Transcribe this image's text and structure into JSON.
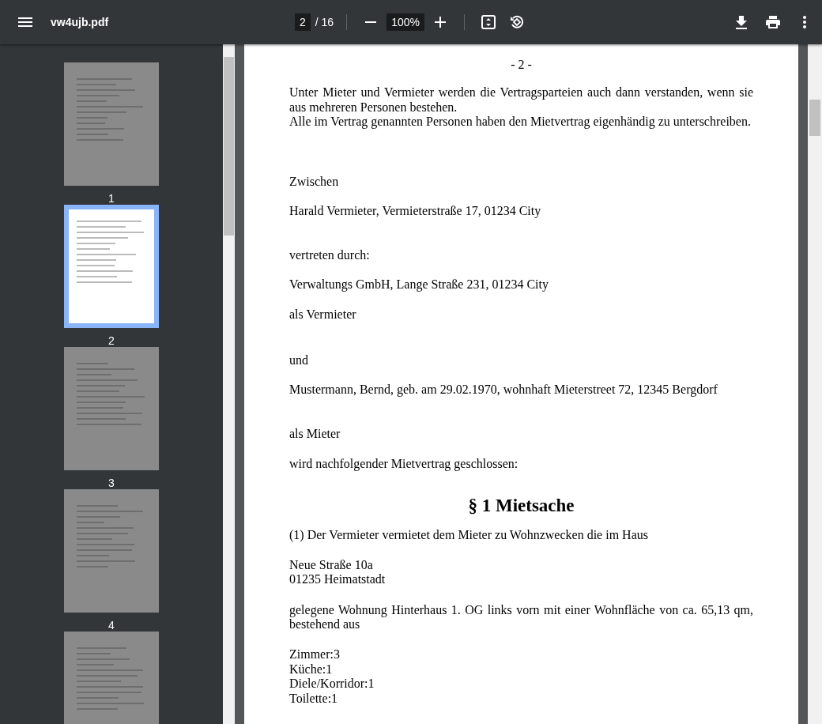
{
  "toolbar": {
    "title": "vw4ujb.pdf",
    "page_input": "2",
    "page_total": "/ 16",
    "zoom": "100%"
  },
  "thumbnails": [
    {
      "label": "1",
      "selected": false
    },
    {
      "label": "2",
      "selected": true
    },
    {
      "label": "3",
      "selected": false
    },
    {
      "label": "4",
      "selected": false
    },
    {
      "selected": false
    }
  ],
  "document": {
    "header": "- 2 -",
    "blocks": [
      {
        "kind": "paragraph",
        "lines": [
          "Unter Mieter und Vermieter werden die Vertragsparteien auch dann verstanden, wenn sie aus mehreren Personen bestehen.",
          "Alle im Vertrag genannten Personen haben den Mietvertrag eigenhändig zu unterschreiben."
        ]
      },
      {
        "kind": "paragraph",
        "lines": [
          "Zwischen"
        ]
      },
      {
        "kind": "paragraph",
        "lines": [
          "Harald Vermieter, Vermieterstraße 17, 01234 City"
        ]
      },
      {
        "kind": "paragraph",
        "lines": [
          "vertreten durch:"
        ]
      },
      {
        "kind": "paragraph",
        "lines": [
          "Verwaltungs GmbH, Lange Straße 231, 01234 City"
        ]
      },
      {
        "kind": "paragraph",
        "lines": [
          "als Vermieter"
        ]
      },
      {
        "kind": "paragraph",
        "lines": [
          "und"
        ]
      },
      {
        "kind": "paragraph",
        "lines": [
          "Mustermann, Bernd, geb. am 29.02.1970, wohnhaft Mieterstreet 72, 12345 Bergdorf"
        ]
      },
      {
        "kind": "paragraph",
        "lines": [
          "als Mieter"
        ]
      },
      {
        "kind": "paragraph",
        "lines": [
          "wird nachfolgender Mietvertrag geschlossen:"
        ]
      },
      {
        "kind": "heading",
        "lines": [
          "§ 1 Mietsache"
        ]
      },
      {
        "kind": "paragraph",
        "lines": [
          "(1) Der Vermieter vermietet dem Mieter zu Wohnzwecken die im Haus"
        ]
      },
      {
        "kind": "paragraph",
        "lines": [
          "Neue Straße 10a",
          "01235 Heimatstadt"
        ]
      },
      {
        "kind": "paragraph",
        "lines": [
          "gelegene Wohnung Hinterhaus 1. OG links vorn mit einer Wohnfläche von ca. 65,13 qm, bestehend aus"
        ]
      },
      {
        "kind": "paragraph",
        "lines": [
          "Zimmer:3",
          "Küche:1",
          "Diele/Korridor:1",
          "Toilette:1"
        ]
      }
    ]
  }
}
